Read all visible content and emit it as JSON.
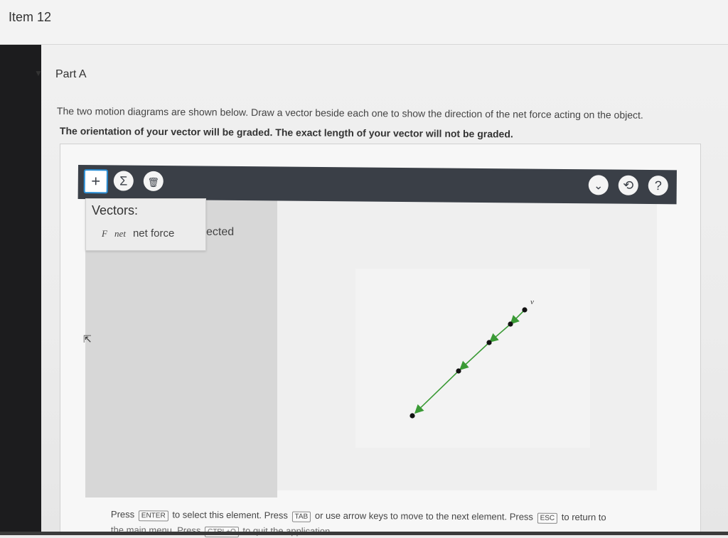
{
  "item": {
    "title": "Item 12"
  },
  "part": {
    "title": "Part A",
    "toggle_icon": "triangle-down-icon"
  },
  "instructions": {
    "line1": "The two motion diagrams are shown below. Draw a vector beside each one to show the direction of the net force acting on the object.",
    "line2": "The orientation of your vector will be graded. The exact length of your vector will not be graded."
  },
  "toolbar": {
    "left_buttons": [
      {
        "name": "add-vector-button",
        "icon": "plus-icon",
        "glyph": "+"
      },
      {
        "name": "sum-button",
        "icon": "sigma-icon",
        "glyph": "Σ"
      },
      {
        "name": "delete-button",
        "icon": "trash-icon",
        "glyph": "🗑"
      }
    ],
    "right_buttons": [
      {
        "name": "dropdown-button",
        "icon": "chevron-down-icon",
        "glyph": "⌄"
      },
      {
        "name": "reset-button",
        "icon": "reset-icon",
        "glyph": "⟲"
      },
      {
        "name": "help-button",
        "icon": "help-icon",
        "glyph": "?"
      }
    ]
  },
  "vectors_menu": {
    "title": "Vectors:",
    "item_symbol": "F⃗net",
    "item_label": "net force"
  },
  "partial_label": "ected",
  "diagram": {
    "velocity_label": "v⃗",
    "points_count": 5
  },
  "keyboard_help": {
    "p1": "Press",
    "k1": "ENTER",
    "p2": "to select this element. Press",
    "k2": "TAB",
    "p3": "or use arrow keys to move to the next element. Press",
    "k3": "ESC",
    "p4": "to return to",
    "line2": "the main menu. Press",
    "k4": "CTRL+Q",
    "p5": "to quit the application."
  },
  "colors": {
    "toolbar_bg": "#3a3f47",
    "arrow_green": "#3a9a35",
    "point_black": "#111111"
  }
}
